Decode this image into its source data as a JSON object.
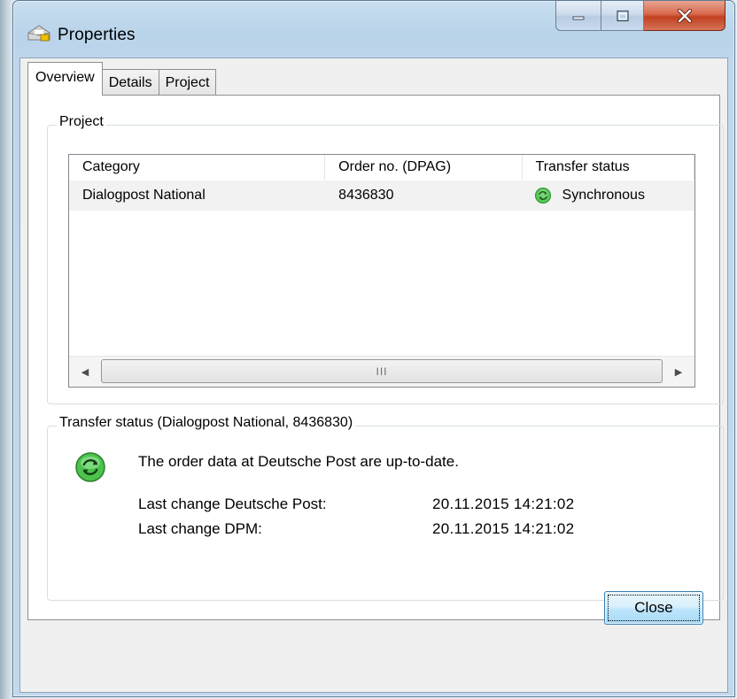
{
  "window": {
    "title": "Properties"
  },
  "tabs": [
    {
      "label": "Overview",
      "active": true
    },
    {
      "label": "Details",
      "active": false
    },
    {
      "label": "Project",
      "active": false
    }
  ],
  "project_group": {
    "label": "Project",
    "columns": [
      "Category",
      "Order no. (DPAG)",
      "Transfer status"
    ],
    "rows": [
      {
        "category": "Dialogpost National",
        "order_no": "8436830",
        "transfer_status": "Synchronous",
        "status_icon": "sync-icon"
      }
    ],
    "scrollbar_grip": "III"
  },
  "transfer_group": {
    "label": "Transfer status (Dialogpost National, 8436830)",
    "message": "The order data at Deutsche Post are up-to-date.",
    "last_change_dp_label": "Last change Deutsche Post:",
    "last_change_dp_value": "20.11.2015 14:21:02",
    "last_change_dpm_label": "Last change DPM:",
    "last_change_dpm_value": "20.11.2015 14:21:02",
    "status_icon": "sync-icon"
  },
  "footer": {
    "close_label": "Close"
  },
  "colors": {
    "sync_green": "#3fbf3f",
    "close_red": "#c1401f"
  }
}
